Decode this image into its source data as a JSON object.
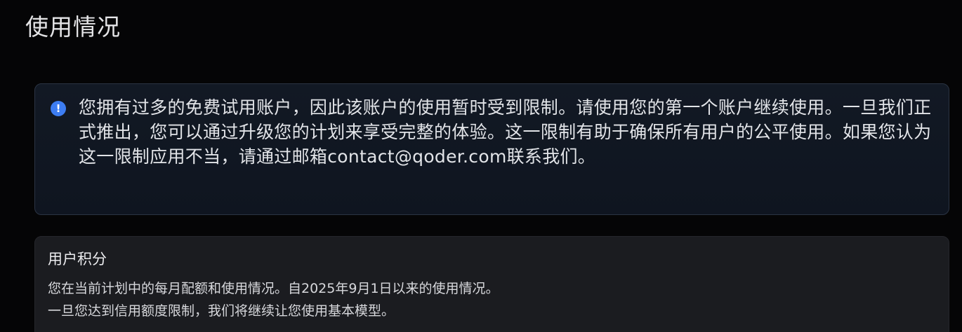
{
  "page": {
    "title": "使用情况"
  },
  "alert": {
    "icon": "info-icon",
    "icon_glyph": "!",
    "accent_color": "#3d7df2",
    "message": "您拥有过多的免费试用账户，因此该账户的使用暂时受到限制。请使用您的第一个账户继续使用。一旦我们正式推出，您可以通过升级您的计划来享受完整的体验。这一限制有助于确保所有用户的公平使用。如果您认为这一限制应用不当，请通过邮箱contact@qoder.com联系我们。"
  },
  "usage": {
    "title": "用户积分",
    "description_line1": "您在当前计划中的每月配额和使用情况。自2025年9月1日以来的使用情况。",
    "description_line2": "一旦您达到信用额度限制，我们将继续让您使用基本模型。"
  }
}
